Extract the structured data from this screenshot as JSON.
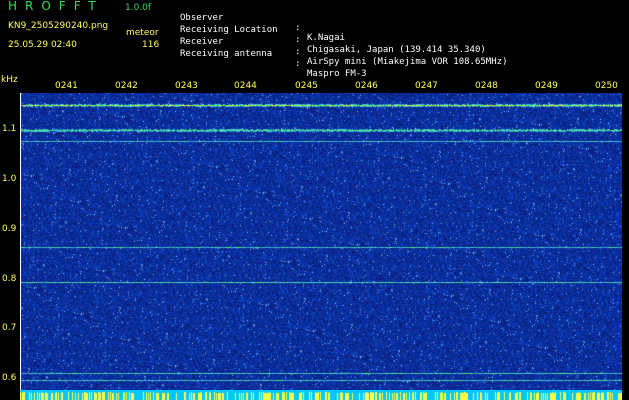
{
  "colors": {
    "title_green": "#33dd55",
    "label_yellow": "#ffff55",
    "info_white": "#ffffff",
    "background": "#000000",
    "spectrum_blue": "#1030b0"
  },
  "header": {
    "logo": "HROFFT",
    "version": "1.0.0f",
    "filename": "KN9_2505290240.png",
    "datetime": "25.05.29 02:40",
    "meteor_label": "meteor",
    "meteor_count": "116"
  },
  "info": [
    {
      "key": "Observer",
      "value": "K.Nagai"
    },
    {
      "key": "Receiving Location",
      "value": "Chigasaki, Japan (139.414 35.340)"
    },
    {
      "key": "Receiver",
      "value": "AirSpy mini (Miakejima VOR 108.65MHz)"
    },
    {
      "key": "Receiving antenna",
      "value": "Maspro FM-3"
    }
  ],
  "axes": {
    "y_unit": "kHz",
    "y_ticks": [
      "1.1",
      "1.0",
      "0.9",
      "0.8",
      "0.7",
      "0.6"
    ],
    "x_ticks": [
      "0241",
      "0242",
      "0243",
      "0244",
      "0245",
      "0246",
      "0247",
      "0248",
      "0249",
      "0250"
    ]
  },
  "spectrogram": {
    "y_range_khz": [
      0.58,
      1.17
    ],
    "carrier_lines_khz": [
      {
        "freq": 1.147,
        "strength": 1.0
      },
      {
        "freq": 1.097,
        "strength": 0.85
      },
      {
        "freq": 1.075,
        "strength": 0.35
      },
      {
        "freq": 0.867,
        "strength": 0.45
      },
      {
        "freq": 0.799,
        "strength": 0.6
      },
      {
        "freq": 0.62,
        "strength": 0.5
      },
      {
        "freq": 0.606,
        "strength": 0.5
      }
    ]
  }
}
